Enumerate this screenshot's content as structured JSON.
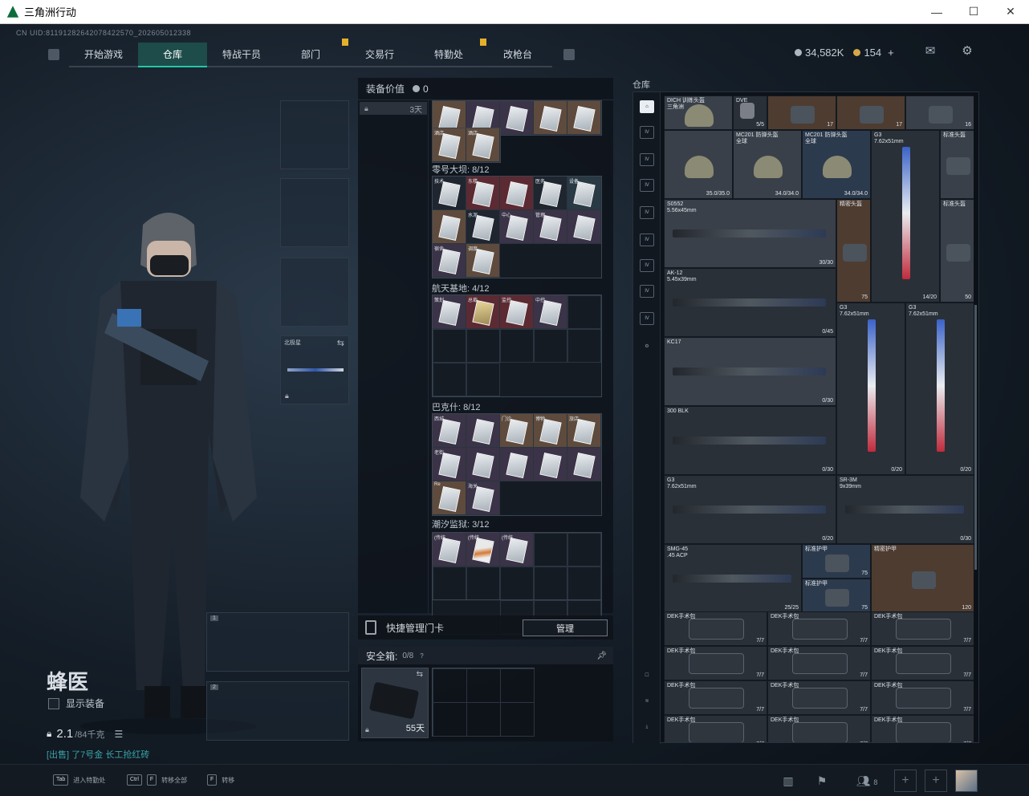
{
  "window": {
    "title": "三角洲行动",
    "min": "—",
    "max": "☐",
    "close": "✕"
  },
  "uid": "CN UID:81191282642078422570_202605012338",
  "nav": {
    "tabs": [
      "开始游戏",
      "仓库",
      "特战干员",
      "部门",
      "交易行",
      "特勤处",
      "改枪台"
    ],
    "active": 1
  },
  "currency": {
    "coins": "34,582K",
    "tickets": "154",
    "plus": "+",
    "coin_color": "#aeb6be",
    "ticket_color": "#d6a84a"
  },
  "icons": {
    "mail": "mail-icon",
    "settings": "gear-icon"
  },
  "character": {
    "name": "蜂医",
    "show_equip": "显示装备",
    "weight": "2.1",
    "weight_max": "/84千克",
    "hint": "[出售] 了7号金 长工抢红砖"
  },
  "slots": {
    "weapon_slot_label": "北极星",
    "slot1": "1",
    "slot2": "2"
  },
  "stash": {
    "title": "装备价值",
    "value": "0",
    "days": "3天",
    "sections": [
      {
        "name": "零号大坝: 8/12"
      },
      {
        "name": "航天基地: 4/12"
      },
      {
        "name": "巴克什: 8/12"
      },
      {
        "name": "潮汐监狱: 3/12"
      }
    ],
    "cards_top": [
      "",
      "",
      "",
      "",
      ""
    ],
    "cards_top2": [
      "酒店",
      "酒店"
    ],
    "cards_dam": [
      "技术",
      "东楼",
      "",
      "医务",
      "设备",
      "",
      "水泥",
      "中心",
      "管理",
      "",
      "宿舍",
      "调度"
    ],
    "cards_space": [
      "策划",
      "总裁",
      "监控",
      "中控"
    ],
    "cards_bakh": [
      "西城",
      "",
      "门诊",
      "博物",
      "旅店",
      "老街",
      "",
      "",
      "",
      "",
      "Re",
      "海关"
    ],
    "cards_prison": [
      "(传统",
      "(传统",
      "(传统"
    ]
  },
  "quick": {
    "label": "快捷管理门卡",
    "button": "管理"
  },
  "safe": {
    "label": "安全箱:",
    "count": "0/8",
    "days": "55天"
  },
  "warehouse": {
    "title": "仓库",
    "items": [
      {
        "n": "DICH 训练头盔\n三角洲"
      },
      {
        "n": "DVE"
      },
      {
        "n": "5/5"
      },
      {
        "n": "17"
      },
      {
        "n": "17"
      },
      {
        "n": "16"
      },
      {
        "n": "35.0/35.0"
      },
      {
        "n": "MC201 防弹头盔\n全球"
      },
      {
        "n": "34.0/34.0"
      },
      {
        "n": "MC201 防弹头盔\n全球"
      },
      {
        "n": "34.0/34.0"
      },
      {
        "n": "G3\n7.62x51mm"
      },
      {
        "n": "标准头盔"
      },
      {
        "n": "标准头盔"
      },
      {
        "n": "50"
      },
      {
        "n": "S0552\n5.56x45mm"
      },
      {
        "n": "30/30"
      },
      {
        "n": "精密头盔"
      },
      {
        "n": "75"
      },
      {
        "n": "14/20"
      },
      {
        "n": "标准头盔"
      },
      {
        "n": "50"
      },
      {
        "n": "AK-12\n5.45x39mm"
      },
      {
        "n": "0/45"
      },
      {
        "n": "G3\n7.62x51mm"
      },
      {
        "n": "G3\n7.62x51mm"
      },
      {
        "n": "75"
      },
      {
        "n": "KC17"
      },
      {
        "n": "0/30"
      },
      {
        "n": "300 BLK"
      },
      {
        "n": "0/30"
      },
      {
        "n": "0/20"
      },
      {
        "n": "0/20"
      },
      {
        "n": "G3\n7.62x51mm"
      },
      {
        "n": "0/20"
      },
      {
        "n": "SR-3M\n9x39mm"
      },
      {
        "n": "0/30"
      },
      {
        "n": "SMG-45\n.45 ACP"
      },
      {
        "n": "25/25"
      },
      {
        "n": "标准护甲"
      },
      {
        "n": "75"
      },
      {
        "n": "标准护甲"
      },
      {
        "n": "75"
      },
      {
        "n": "精密护甲"
      },
      {
        "n": "120"
      },
      {
        "n": "DEK手术包"
      },
      {
        "n": "7/7"
      }
    ]
  },
  "bottom": {
    "tab_key": "Tab",
    "tab_label": "进入特勤处",
    "ctrl_key": "Ctrl",
    "f_key": "F",
    "ctrl_label": "转移全部",
    "f_key2": "F",
    "f_label": "转移",
    "friends": "8"
  }
}
